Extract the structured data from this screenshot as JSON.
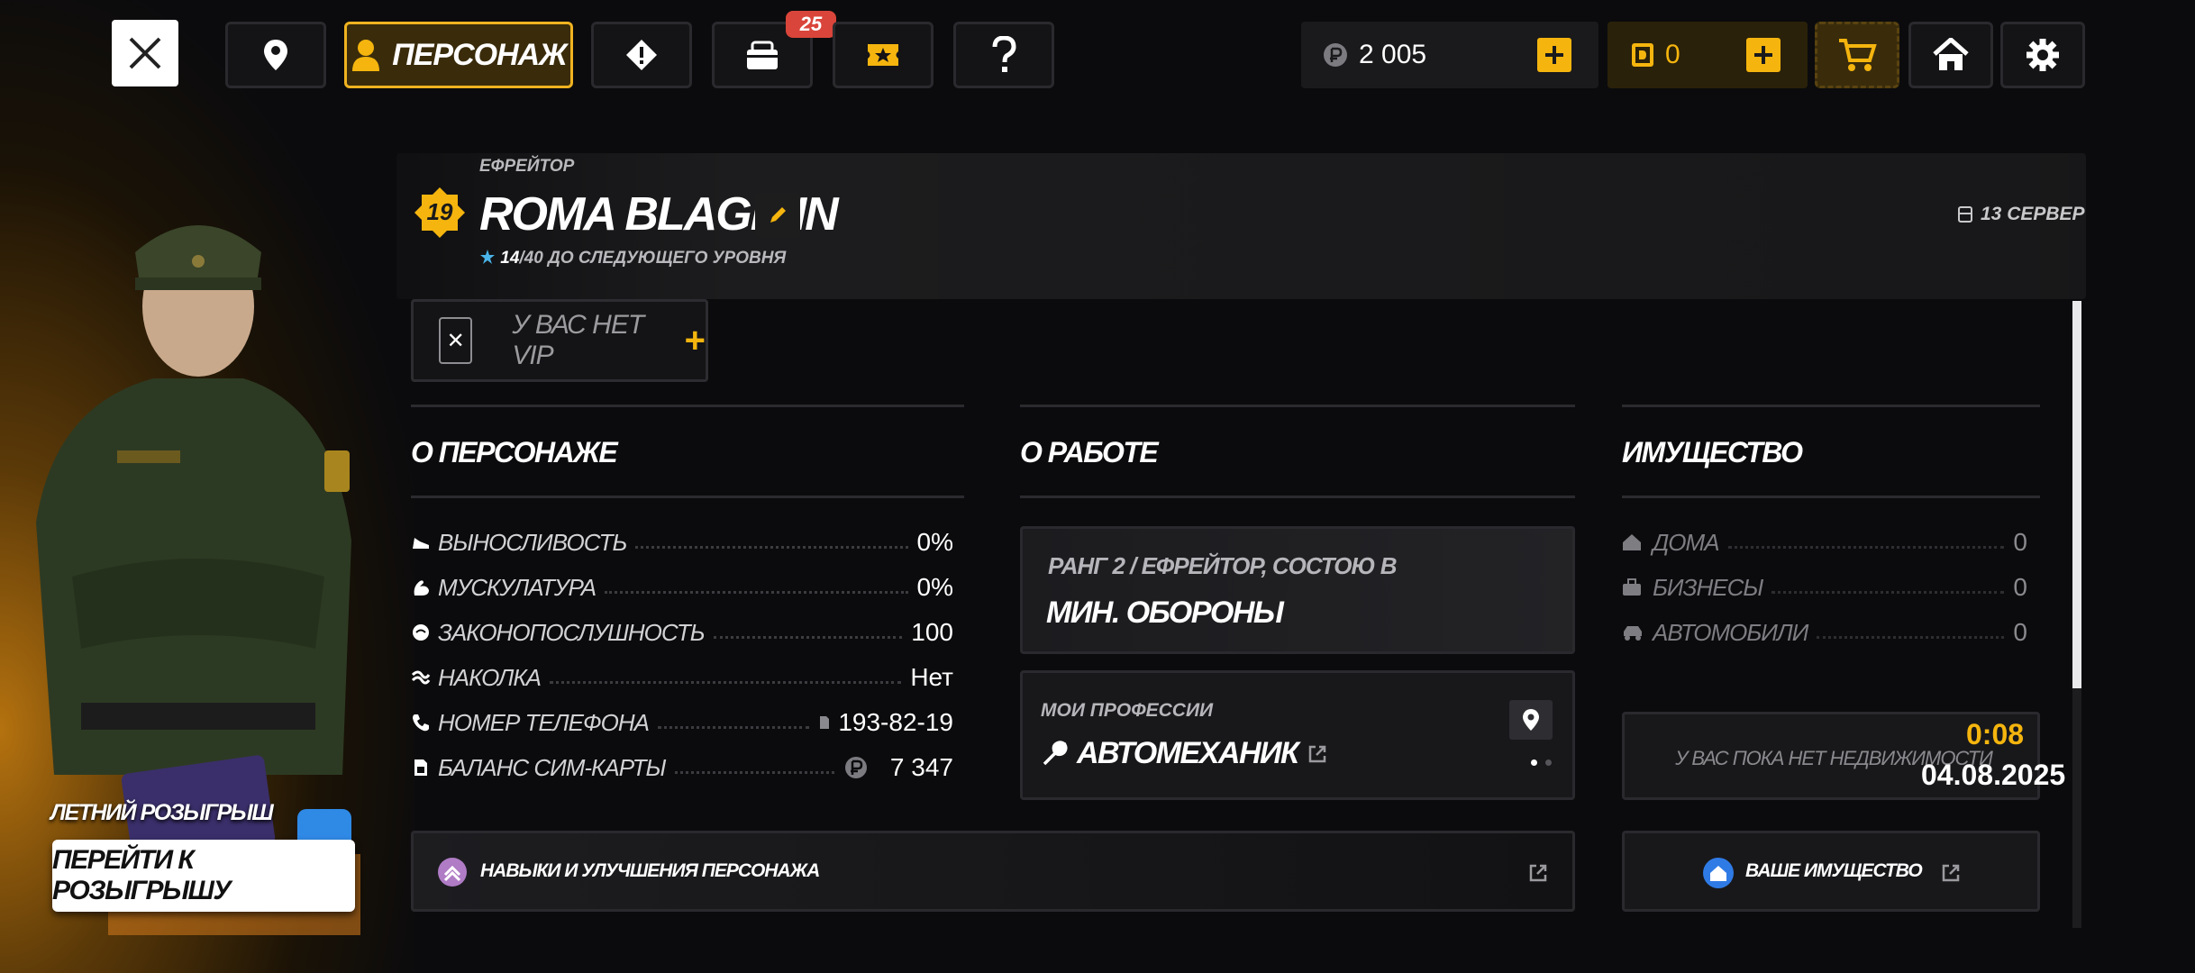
{
  "nav": {
    "gifts_badge": "25",
    "character_label": "ПЕРСОНАЖ"
  },
  "currency": {
    "rubles": "2 005",
    "donate": "0"
  },
  "profile": {
    "rank": "ЕФРЕЙТОР",
    "level": "19",
    "name": "ROMA BLAGININ",
    "xp_current": "14",
    "xp_rest": "/40 ДО СЛЕДУЮЩЕГО УРОВНЯ",
    "server": "13 СЕРВЕР",
    "vip_text": "У ВАС НЕТ VIP"
  },
  "about": {
    "title": "О ПЕРСОНАЖЕ",
    "stats": [
      {
        "label": "ВЫНОСЛИВОСТЬ",
        "value": "0%"
      },
      {
        "label": "МУСКУЛАТУРА",
        "value": "0%"
      },
      {
        "label": "ЗАКОНОПОСЛУШНОСТЬ",
        "value": "100"
      },
      {
        "label": "НАКОЛКА",
        "value": "Нет"
      },
      {
        "label": "НОМЕР ТЕЛЕФОНА",
        "value": "193-82-19"
      },
      {
        "label": "БАЛАНС СИМ-КАРТЫ",
        "value": "7 347"
      }
    ]
  },
  "work": {
    "title": "О РАБОТЕ",
    "rank_line": "РАНГ 2 / ЕФРЕЙТОР, СОСТОЮ В",
    "organization": "МИН. ОБОРОНЫ",
    "professions_title": "МОИ ПРОФЕССИИ",
    "profession": "АВТОМЕХАНИК"
  },
  "property": {
    "title": "ИМУЩЕСТВО",
    "items": [
      {
        "label": "ДОМА",
        "value": "0"
      },
      {
        "label": "БИЗНЕСЫ",
        "value": "0"
      },
      {
        "label": "АВТОМОБИЛИ",
        "value": "0"
      }
    ],
    "empty_text": "У ВАС ПОКА НЕТ НЕДВИЖИМОСТИ",
    "button": "ВАШЕ ИМУЩЕСТВО"
  },
  "skills_button": "НАВЫКИ И УЛУЧШЕНИЯ ПЕРСОНАЖА",
  "clock": {
    "time": "0:08",
    "date": "04.08.2025"
  },
  "promo": {
    "title": "ЛЕТНИЙ РОЗЫГРЫШ",
    "button": "ПЕРЕЙТИ К РОЗЫГРЫШУ"
  },
  "colors": {
    "accent": "#f5b50e",
    "badge": "#d9453a",
    "background": "#0b0b0d"
  }
}
